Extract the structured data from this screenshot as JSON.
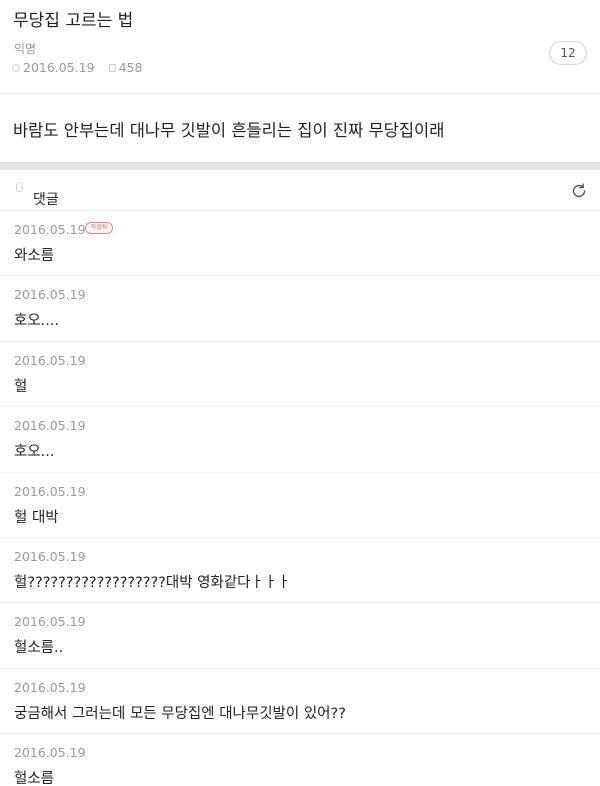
{
  "post": {
    "title": "무당집 고르는 법",
    "author": "익명",
    "date": "2016.05.19",
    "views": "458",
    "comment_count": "12",
    "body": "바람도 안부는데 대나무 깃발이 흔들리는 집이 진짜 무당집이래"
  },
  "comments_section": {
    "label": "댓글",
    "comments": [
      {
        "date": "2016.05.19",
        "text": "와소름",
        "badge": "작성자"
      },
      {
        "date": "2016.05.19",
        "text": "호오...."
      },
      {
        "date": "2016.05.19",
        "text": "헐"
      },
      {
        "date": "2016.05.19",
        "text": "호오..."
      },
      {
        "date": "2016.05.19",
        "text": "헐 대박"
      },
      {
        "date": "2016.05.19",
        "text": "헐??????????????????대박 영화같다ㅏㅏㅏ"
      },
      {
        "date": "2016.05.19",
        "text": "헐소름.."
      },
      {
        "date": "2016.05.19",
        "text": "궁금해서 그러는데 모든 무당집엔 대나무깃발이 있어??"
      },
      {
        "date": "2016.05.19",
        "text": "헐소름"
      }
    ]
  },
  "icons": {
    "author_icon": "person-icon",
    "date_icon": "clock-icon",
    "views_icon": "eye-icon",
    "comment_label_icon": "comment-icon",
    "refresh": "refresh-icon"
  }
}
